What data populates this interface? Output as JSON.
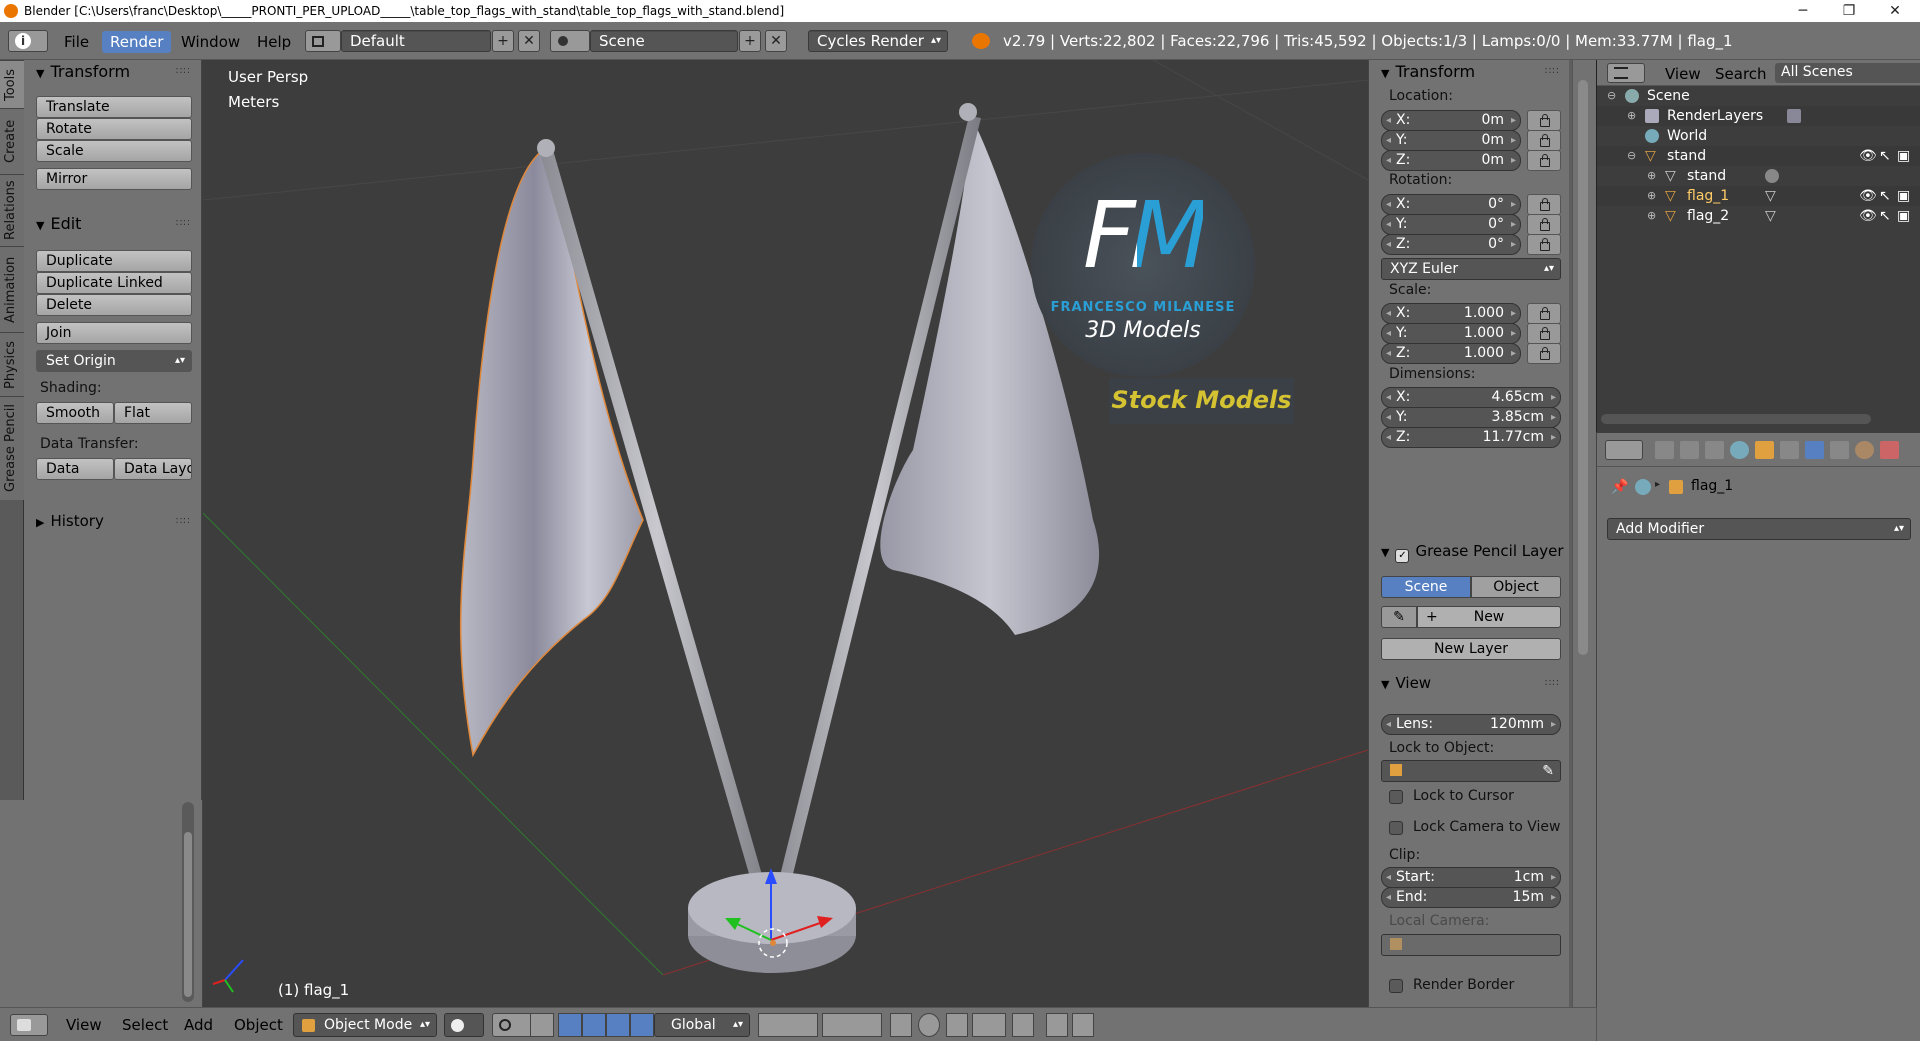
{
  "window": {
    "title": "Blender [C:\\Users\\franc\\Desktop\\_____PRONTI_PER_UPLOAD_____\\table_top_flags_with_stand\\table_top_flags_with_stand.blend]",
    "minimize": "─",
    "restore": "❐",
    "close": "✕"
  },
  "header": {
    "info_icon": "i",
    "menus": [
      "File",
      "Render",
      "Window",
      "Help"
    ],
    "active_menu": "Render",
    "layout": "Default",
    "scene": "Scene",
    "engine": "Cycles Render",
    "stats": "v2.79 | Verts:22,802 | Faces:22,796 | Tris:45,592 | Objects:1/3 | Lamps:0/0 | Mem:33.77M | flag_1",
    "add_symbol": "+",
    "remove_symbol": "✕"
  },
  "tool_tabs": [
    "Tools",
    "Create",
    "Relations",
    "Animation",
    "Physics",
    "Grease Pencil"
  ],
  "toolshelf": {
    "transform_title": "Transform",
    "translate": "Translate",
    "rotate": "Rotate",
    "scale": "Scale",
    "mirror": "Mirror",
    "edit_title": "Edit",
    "duplicate": "Duplicate",
    "duplicate_linked": "Duplicate Linked",
    "delete": "Delete",
    "join": "Join",
    "set_origin": "Set Origin",
    "shading_label": "Shading:",
    "smooth": "Smooth",
    "flat": "Flat",
    "data_transfer_label": "Data Transfer:",
    "data": "Data",
    "data_layout": "Data Layo",
    "history_title": "History"
  },
  "viewport": {
    "view_name": "User Persp",
    "units": "Meters",
    "selected_object": "(1) flag_1",
    "watermark": {
      "monogram": "FM",
      "brand": "FRANCESCO MILANESE",
      "tagline": "3D Models",
      "banner": "Stock Models",
      "accent": "#2a9fd6",
      "banner_color": "#d4c232"
    }
  },
  "npanel": {
    "transform_title": "Transform",
    "location_label": "Location:",
    "location": [
      {
        "k": "X:",
        "v": "0m"
      },
      {
        "k": "Y:",
        "v": "0m"
      },
      {
        "k": "Z:",
        "v": "0m"
      }
    ],
    "rotation_label": "Rotation:",
    "rotation": [
      {
        "k": "X:",
        "v": "0°"
      },
      {
        "k": "Y:",
        "v": "0°"
      },
      {
        "k": "Z:",
        "v": "0°"
      }
    ],
    "rotation_mode": "XYZ Euler",
    "scale_label": "Scale:",
    "scale": [
      {
        "k": "X:",
        "v": "1.000"
      },
      {
        "k": "Y:",
        "v": "1.000"
      },
      {
        "k": "Z:",
        "v": "1.000"
      }
    ],
    "dimensions_label": "Dimensions:",
    "dimensions": [
      {
        "k": "X:",
        "v": "4.65cm"
      },
      {
        "k": "Y:",
        "v": "3.85cm"
      },
      {
        "k": "Z:",
        "v": "11.77cm"
      }
    ],
    "grease_title": "Grease Pencil Layer",
    "scene_tab": "Scene",
    "object_tab": "Object",
    "new": "New",
    "new_layer": "New Layer",
    "view_title": "View",
    "lens_label": "Lens:",
    "lens": "120mm",
    "lock_to_object": "Lock to Object:",
    "lock_to_cursor": "Lock to Cursor",
    "lock_camera": "Lock Camera to View",
    "clip_label": "Clip:",
    "clip_start_label": "Start:",
    "clip_start": "1cm",
    "clip_end_label": "End:",
    "clip_end": "15m",
    "local_camera": "Local Camera:",
    "render_border": "Render Border"
  },
  "outliner": {
    "view": "View",
    "search": "Search",
    "filter": "All Scenes",
    "rows": [
      {
        "label": "Scene",
        "indent": 0
      },
      {
        "label": "RenderLayers",
        "indent": 1
      },
      {
        "label": "World",
        "indent": 1
      },
      {
        "label": "stand",
        "indent": 1
      },
      {
        "label": "stand",
        "indent": 2
      },
      {
        "label": "flag_1",
        "indent": 2
      },
      {
        "label": "flag_2",
        "indent": 2
      }
    ]
  },
  "properties": {
    "object_name": "flag_1",
    "add_modifier": "Add Modifier"
  },
  "footer": {
    "menus": [
      "View",
      "Select",
      "Add",
      "Object"
    ],
    "mode": "Object Mode",
    "orientation": "Global"
  }
}
